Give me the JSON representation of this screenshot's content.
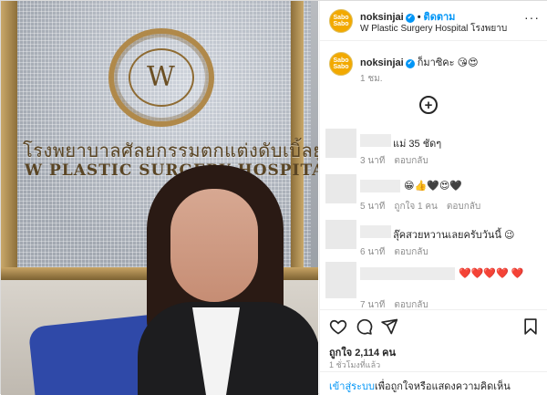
{
  "post_image": {
    "sign_thai": "โรงพยาบาลศัลยกรรมตกแต่งดับเบิ้ลยู",
    "sign_english": "W PLASTIC SURGERY HOSPITAL",
    "logo_letter": "W"
  },
  "header": {
    "avatar_text": "Sabo Sabo",
    "username": "noksinjai",
    "verified_glyph": "✔",
    "separator": "•",
    "follow_label": "ติดตาม",
    "location": "W Plastic Surgery Hospital โรงพยาบ",
    "more_glyph": "···"
  },
  "caption": {
    "username": "noksinjai",
    "text": "ก็มาซิคะ 😘😍",
    "time": "1 ชม."
  },
  "load_more_glyph": "+",
  "comments": [
    {
      "text": "แม่ 35 ชัดๆ",
      "time": "3 นาที",
      "likes": "",
      "reply": "ตอบกลับ"
    },
    {
      "text": "😁👍🖤😍🖤",
      "time": "5 นาที",
      "likes": "ถูกใจ 1 คน",
      "reply": "ตอบกลับ"
    },
    {
      "text": "ลุ๊คสวยหวานเลยครับวันนี้ 😉",
      "time": "6 นาที",
      "likes": "",
      "reply": "ตอบกลับ"
    },
    {
      "text": "❤️❤️❤️❤️ ❤️",
      "time": "7 นาที",
      "likes": "",
      "reply": "ตอบกลับ"
    }
  ],
  "actions": {
    "like_icon": "heart-icon",
    "comment_icon": "comment-icon",
    "share_icon": "send-icon",
    "save_icon": "bookmark-icon"
  },
  "likes_text": "ถูกใจ 2,114 คน",
  "posted_ago": "1 ชั่วโมงที่แล้ว",
  "login_prompt": {
    "link": "เข้าสู่ระบบ",
    "text": "เพื่อถูกใจหรือแสดงความคิดเห็น"
  }
}
